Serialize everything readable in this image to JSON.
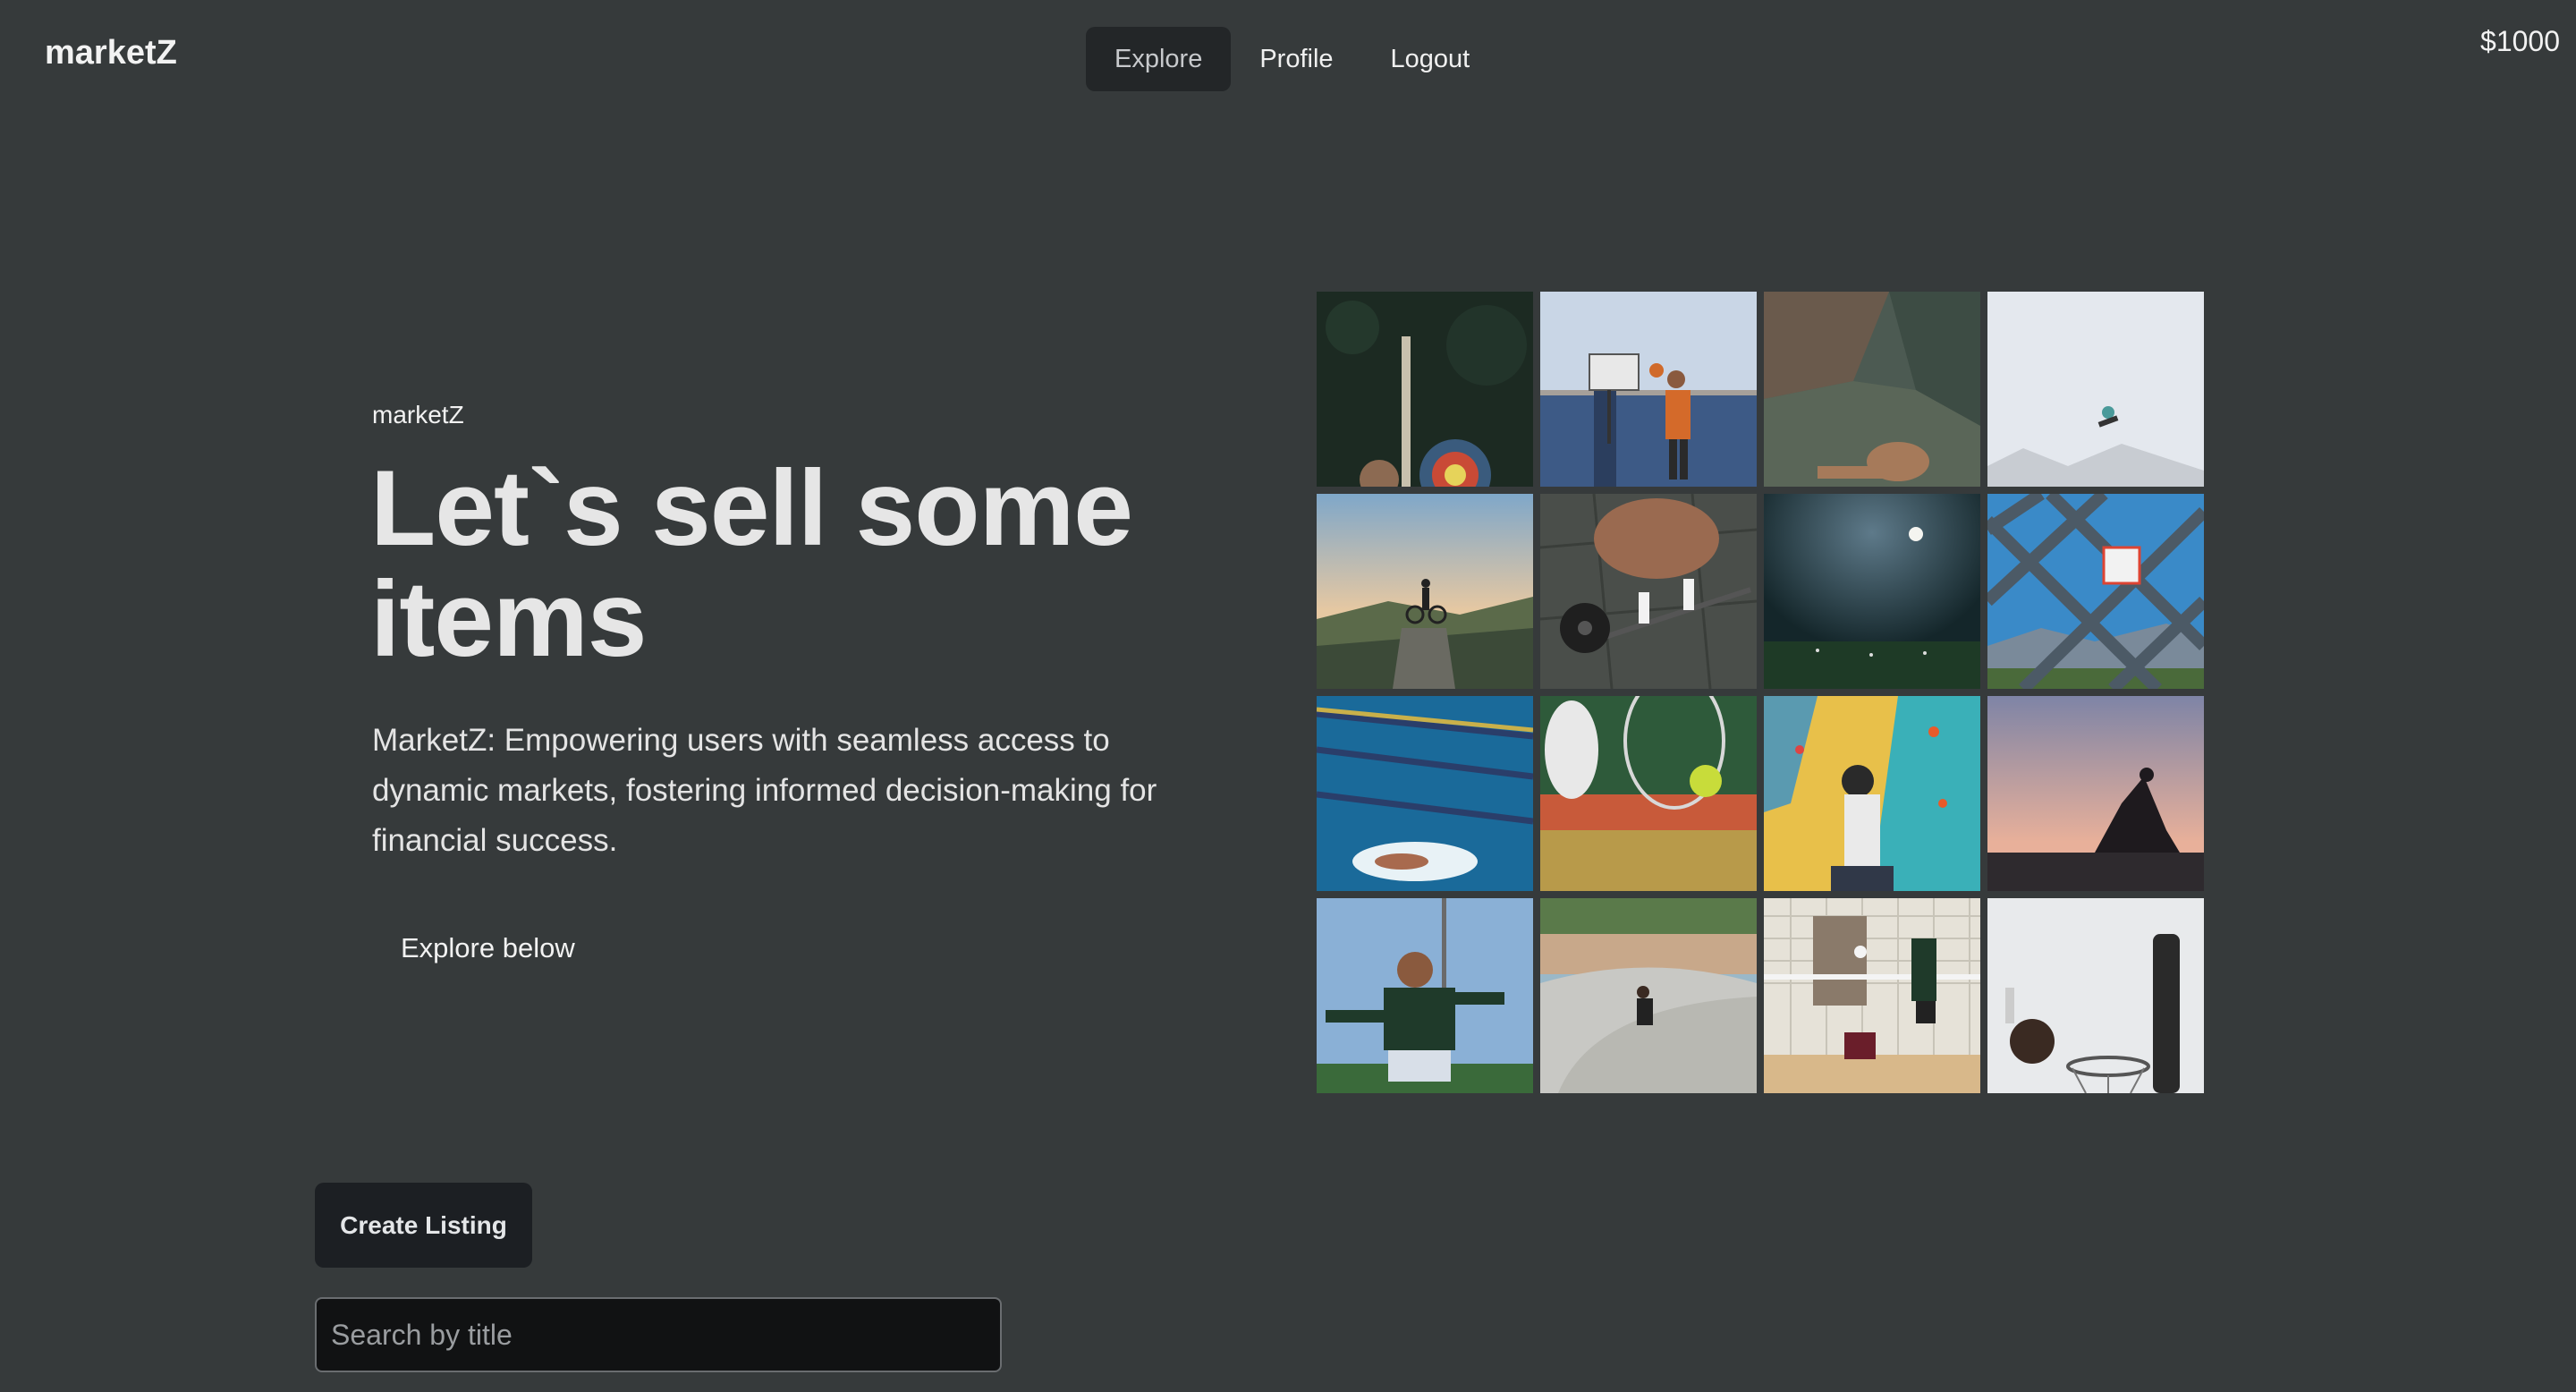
{
  "header": {
    "brand": "marketZ",
    "nav": [
      {
        "label": "Explore",
        "active": true
      },
      {
        "label": "Profile",
        "active": false
      },
      {
        "label": "Logout",
        "active": false
      }
    ],
    "balance": "$1000"
  },
  "hero": {
    "eyebrow": "marketZ",
    "title": "Let`s sell some items",
    "description": "MarketZ: Empowering users with seamless access to dynamic markets, fostering informed decision-making for financial success.",
    "cta": "Explore below"
  },
  "gallery": [
    {
      "icon": "archery-photo"
    },
    {
      "icon": "basketball-dunk-photo"
    },
    {
      "icon": "rock-climbing-photo"
    },
    {
      "icon": "snowboard-jump-photo"
    },
    {
      "icon": "mountain-biker-photo"
    },
    {
      "icon": "deadlift-photo"
    },
    {
      "icon": "night-football-field-photo"
    },
    {
      "icon": "basketball-hoop-fence-photo"
    },
    {
      "icon": "swimming-photo"
    },
    {
      "icon": "tennis-photo"
    },
    {
      "icon": "climbing-wall-photo"
    },
    {
      "icon": "yoga-sunset-photo"
    },
    {
      "icon": "soccer-player-photo"
    },
    {
      "icon": "skatepark-photo"
    },
    {
      "icon": "volleyball-photo"
    },
    {
      "icon": "basketball-shot-photo"
    }
  ],
  "actions": {
    "create_listing": "Create Listing",
    "search_placeholder": "Search by title"
  }
}
